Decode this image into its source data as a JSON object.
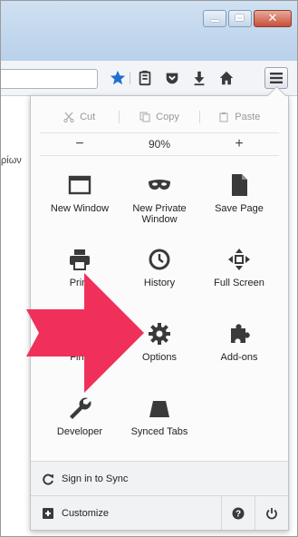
{
  "edit": {
    "cut": "Cut",
    "copy": "Copy",
    "paste": "Paste"
  },
  "zoom": {
    "out": "−",
    "level": "90%",
    "in": "+"
  },
  "grid": [
    {
      "id": "new-window",
      "label": "New Window"
    },
    {
      "id": "new-private-window",
      "label": "New Private Window"
    },
    {
      "id": "save-page",
      "label": "Save Page"
    },
    {
      "id": "print",
      "label": "Print"
    },
    {
      "id": "history",
      "label": "History"
    },
    {
      "id": "full-screen",
      "label": "Full Screen"
    },
    {
      "id": "find",
      "label": "Find"
    },
    {
      "id": "options",
      "label": "Options"
    },
    {
      "id": "add-ons",
      "label": "Add-ons"
    },
    {
      "id": "developer",
      "label": "Developer"
    },
    {
      "id": "synced-tabs",
      "label": "Synced Tabs"
    }
  ],
  "footer": {
    "sync": "Sign in to Sync",
    "customize": "Customize"
  },
  "page": {
    "snippet": "ρίων"
  },
  "colors": {
    "accent_arrow": "#f0305a",
    "star": "#1f6fd1",
    "icon": "#3a3a3a"
  }
}
